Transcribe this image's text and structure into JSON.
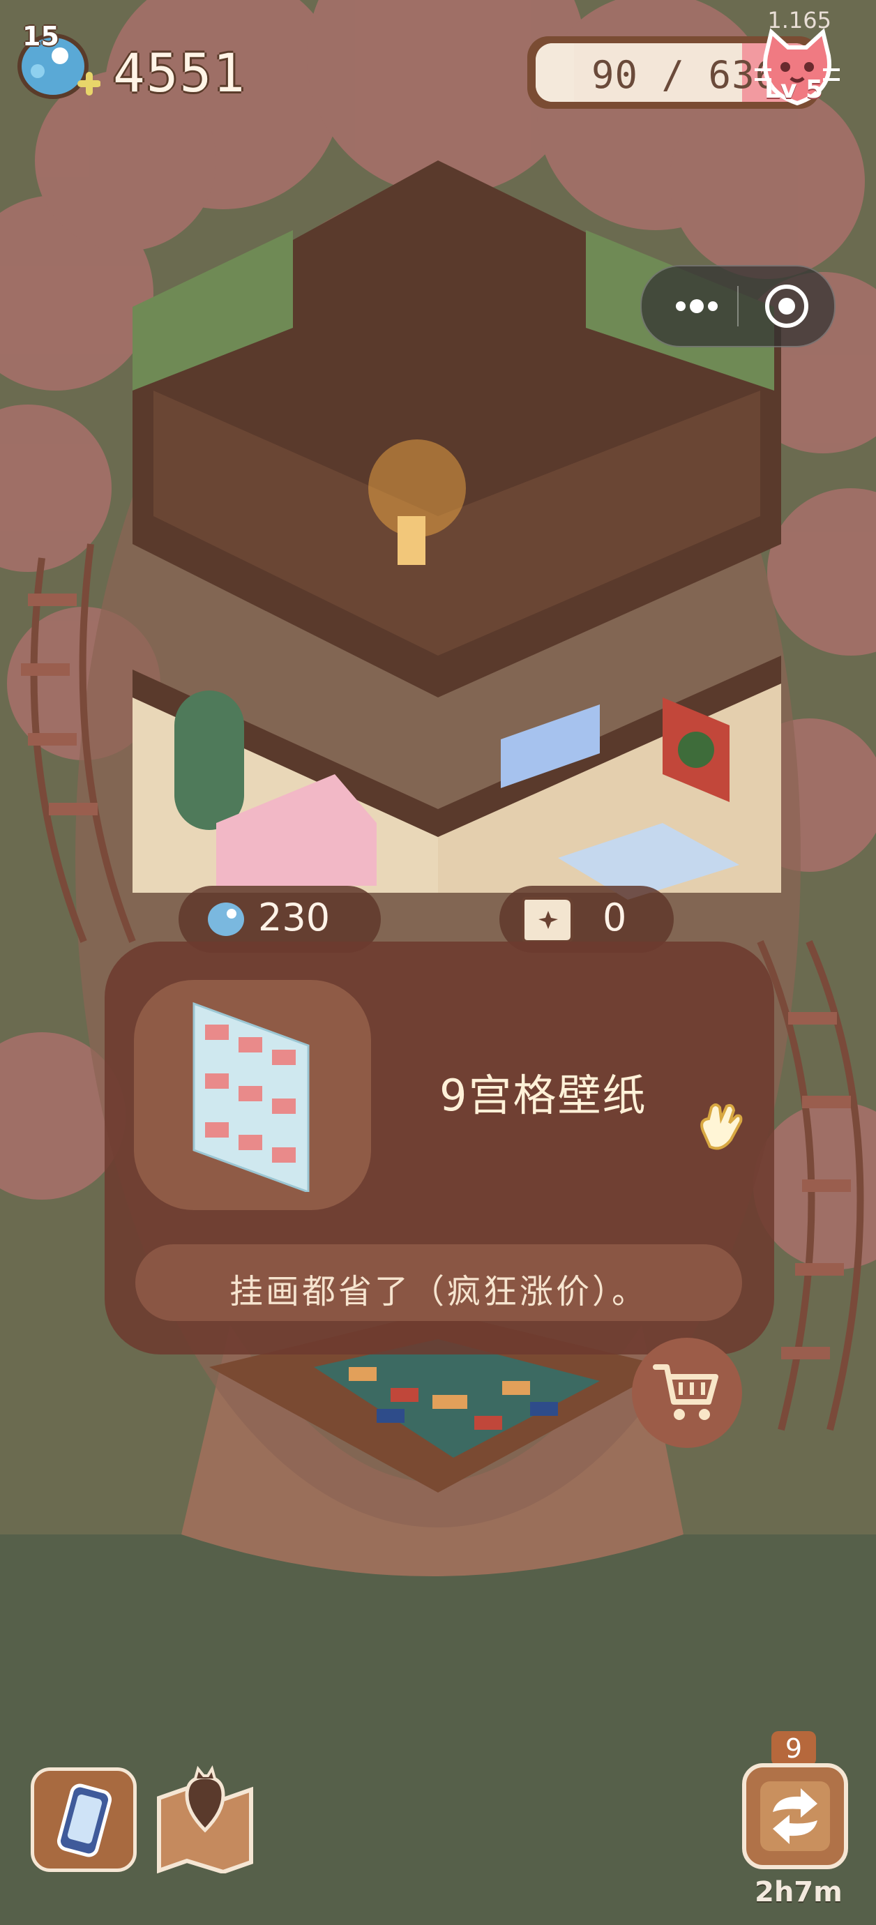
{
  "hud": {
    "coin_level": "15",
    "coin_amount": "4551",
    "version": "1.165",
    "xp_text": "90 / 636",
    "xp_progress": 0.14,
    "cat_level": "Lv 5"
  },
  "miniprogram": {
    "more_icon": "more-dots-icon",
    "close_icon": "target-close-icon"
  },
  "currencies": {
    "fish_amount": "230",
    "map_amount": "0"
  },
  "item_card": {
    "name": "9宫格壁纸",
    "description": "挂画都省了（疯狂涨价）。"
  },
  "bottom_bar": {
    "refresh_count": "9",
    "refresh_timer": "2h7m"
  },
  "colors": {
    "background": "#56604a",
    "card": "#6e3a2e",
    "accent_pink": "#f29aa0"
  }
}
